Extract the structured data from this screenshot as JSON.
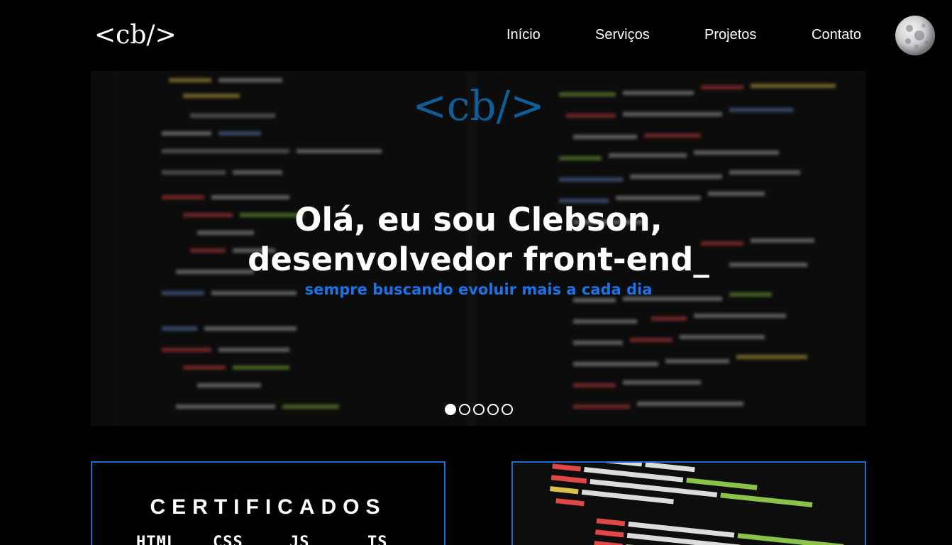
{
  "header": {
    "logo": "<cb/>",
    "nav": [
      "Início",
      "Serviços",
      "Projetos",
      "Contato"
    ]
  },
  "hero": {
    "logo": "<cb/>",
    "title_line1": "Olá, eu sou Clebson,",
    "title_line2": "desenvolvedor front-end_",
    "subtitle": "sempre buscando evoluir mais a cada dia",
    "carousel": {
      "total": 5,
      "active": 1
    }
  },
  "certificados": {
    "title": "CERTIFICADOS",
    "techs": [
      "HTML",
      "CSS",
      "JS",
      "TS"
    ]
  },
  "colors": {
    "accent": "#1a73e8",
    "border": "#1b6fc4",
    "logo_blue": "#0f5e99"
  }
}
